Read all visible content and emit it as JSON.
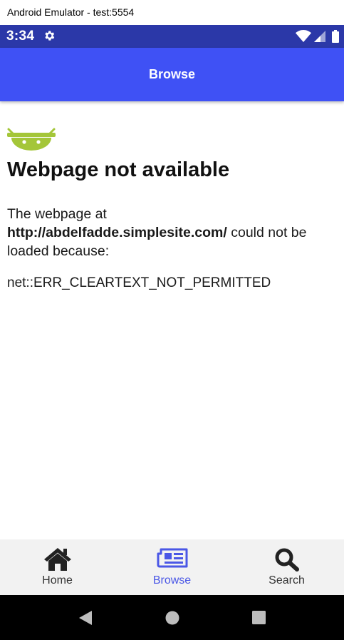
{
  "window": {
    "title": "Android Emulator - test:5554"
  },
  "status_bar": {
    "time": "3:34"
  },
  "app_bar": {
    "title": "Browse"
  },
  "error_page": {
    "title": "Webpage not available",
    "msg_prefix": "The webpage at",
    "url": "http://abdelfadde.simplesite.com/",
    "msg_suffix": " could not be loaded because:",
    "error_code": "net::ERR_CLEARTEXT_NOT_PERMITTED"
  },
  "tabs": [
    {
      "label": "Home",
      "icon": "home-icon",
      "active": false
    },
    {
      "label": "Browse",
      "icon": "newspaper-icon",
      "active": true
    },
    {
      "label": "Search",
      "icon": "search-icon",
      "active": false
    }
  ],
  "colors": {
    "status_bar": "#2b38a8",
    "app_bar": "#3f51f5",
    "active_tab": "#4a57e6",
    "android_green": "#a4c639"
  }
}
